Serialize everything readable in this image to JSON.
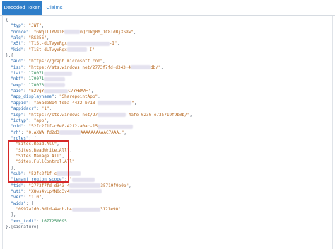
{
  "tabs": [
    {
      "label": "Decoded Token",
      "active": true
    },
    {
      "label": "Claims",
      "active": false
    }
  ],
  "token_lines": [
    {
      "t": [
        [
          "p",
          "{"
        ]
      ]
    },
    {
      "t": [
        [
          "p",
          "  "
        ],
        [
          "k",
          "\"typ\""
        ],
        [
          "p",
          ": "
        ],
        [
          "s",
          "\"JWT\""
        ],
        [
          "p",
          ","
        ]
      ]
    },
    {
      "t": [
        [
          "p",
          "  "
        ],
        [
          "k",
          "\"nonce\""
        ],
        [
          "p",
          ": "
        ],
        [
          "s",
          "\"GWqIITYV910"
        ],
        [
          "b",
          ""
        ],
        [
          "s",
          "mQr1kg0M_1C8ldBjXS8w\""
        ],
        [
          "p",
          ","
        ]
      ]
    },
    {
      "t": [
        [
          "p",
          "  "
        ],
        [
          "k",
          "\"alg\""
        ],
        [
          "p",
          ": "
        ],
        [
          "s",
          "\"RS256\""
        ],
        [
          "p",
          ","
        ]
      ]
    },
    {
      "t": [
        [
          "p",
          "  "
        ],
        [
          "k",
          "\"x5t\""
        ],
        [
          "p",
          ": "
        ],
        [
          "s",
          "\"T1St-dLTvyWRgx"
        ],
        [
          "b",
          ""
        ],
        [
          "s",
          "-I\""
        ],
        [
          "p",
          ","
        ]
      ]
    },
    {
      "t": [
        [
          "p",
          "  "
        ],
        [
          "k",
          "\"kid\""
        ],
        [
          "p",
          ": "
        ],
        [
          "s",
          "\"T1St-dLTvyWRgx"
        ],
        [
          "b",
          ""
        ],
        [
          "s",
          "-I\""
        ]
      ]
    },
    {
      "t": [
        [
          "p",
          "}.{"
        ]
      ]
    },
    {
      "t": [
        [
          "p",
          "  "
        ],
        [
          "k",
          "\"aud\""
        ],
        [
          "p",
          ": "
        ],
        [
          "s",
          "\"https://graph.microsoft.com\""
        ],
        [
          "p",
          ","
        ]
      ]
    },
    {
      "t": [
        [
          "p",
          "  "
        ],
        [
          "k",
          "\"iss\""
        ],
        [
          "p",
          ": "
        ],
        [
          "s",
          "\"https://sts.windows.net/2773f7fd-d343-4"
        ],
        [
          "b",
          ""
        ],
        [
          "s",
          "db/\""
        ],
        [
          "p",
          ","
        ]
      ]
    },
    {
      "t": [
        [
          "p",
          "  "
        ],
        [
          "k",
          "\"iat\""
        ],
        [
          "p",
          ": "
        ],
        [
          "n",
          "170071"
        ],
        [
          "b",
          ""
        ]
      ]
    },
    {
      "t": [
        [
          "p",
          "  "
        ],
        [
          "k",
          "\"nbf\""
        ],
        [
          "p",
          ": "
        ],
        [
          "n",
          "170071"
        ],
        [
          "b",
          ""
        ]
      ]
    },
    {
      "t": [
        [
          "p",
          "  "
        ],
        [
          "k",
          "\"exp\""
        ],
        [
          "p",
          ": "
        ],
        [
          "n",
          "170073"
        ],
        [
          "b",
          ""
        ]
      ]
    },
    {
      "t": [
        [
          "p",
          "  "
        ],
        [
          "k",
          "\"aio\""
        ],
        [
          "p",
          ": "
        ],
        [
          "s",
          "\"E2VgY"
        ],
        [
          "b",
          ""
        ],
        [
          "s",
          "C7Y+BAA=\""
        ],
        [
          "p",
          ","
        ]
      ]
    },
    {
      "t": [
        [
          "p",
          "  "
        ],
        [
          "k",
          "\"app_displayname\""
        ],
        [
          "p",
          ": "
        ],
        [
          "s",
          "\"SharepointApp\""
        ],
        [
          "p",
          ","
        ]
      ]
    },
    {
      "t": [
        [
          "p",
          "  "
        ],
        [
          "k",
          "\"appid\""
        ],
        [
          "p",
          ": "
        ],
        [
          "s",
          "\"a6ade814-fdba-4432-b718-"
        ],
        [
          "b",
          ""
        ],
        [
          "s",
          "\""
        ],
        [
          "p",
          ","
        ]
      ]
    },
    {
      "t": [
        [
          "p",
          "  "
        ],
        [
          "k",
          "\"appidacr\""
        ],
        [
          "p",
          ": "
        ],
        [
          "s",
          "\"1\""
        ],
        [
          "p",
          ","
        ]
      ]
    },
    {
      "t": [
        [
          "p",
          "  "
        ],
        [
          "k",
          "\"idp\""
        ],
        [
          "p",
          ": "
        ],
        [
          "s",
          "\"https://sts.windows.net/27"
        ],
        [
          "b",
          ""
        ],
        [
          "s",
          "-4afe-0230-e735719f9b0b/\""
        ],
        [
          "p",
          ","
        ]
      ]
    },
    {
      "t": [
        [
          "p",
          "  "
        ],
        [
          "k",
          "\"idtyp\""
        ],
        [
          "p",
          ": "
        ],
        [
          "s",
          "\"app\""
        ],
        [
          "p",
          ","
        ]
      ]
    },
    {
      "t": [
        [
          "p",
          "  "
        ],
        [
          "k",
          "\"oid\""
        ],
        [
          "p",
          ": "
        ],
        [
          "s",
          "\"52fc2f1f-c6e0-42f2-a0ac-15"
        ],
        [
          "b",
          ""
        ]
      ]
    },
    {
      "t": [
        [
          "p",
          "  "
        ],
        [
          "k",
          "\"rh\""
        ],
        [
          "p",
          ": "
        ],
        [
          "s",
          "\"0.AXWA_fd2d3"
        ],
        [
          "b",
          ""
        ],
        [
          "s",
          "AAAAAAAAAAC7AAA.\""
        ],
        [
          "p",
          ","
        ]
      ]
    },
    {
      "t": [
        [
          "p",
          "  "
        ],
        [
          "k",
          "\"roles\""
        ],
        [
          "p",
          ": ["
        ]
      ]
    },
    {
      "t": [
        [
          "p",
          "    "
        ],
        [
          "s",
          "\"Sites.Read.All\""
        ],
        [
          "p",
          ","
        ]
      ]
    },
    {
      "t": [
        [
          "p",
          "    "
        ],
        [
          "s",
          "\"Sites.ReadWrite.All\""
        ],
        [
          "p",
          ","
        ]
      ]
    },
    {
      "t": [
        [
          "p",
          "    "
        ],
        [
          "s",
          "\"Sites.Manage.All\""
        ],
        [
          "p",
          ","
        ]
      ]
    },
    {
      "t": [
        [
          "p",
          "    "
        ],
        [
          "s",
          "\"Sites.FullControl.All\""
        ]
      ]
    },
    {
      "t": [
        [
          "p",
          "  ],"
        ]
      ]
    },
    {
      "t": [
        [
          "p",
          "  "
        ],
        [
          "k",
          "\"sub\""
        ],
        [
          "p",
          ": "
        ],
        [
          "s",
          "\"52fc2f1f-c"
        ],
        [
          "b",
          ""
        ]
      ]
    },
    {
      "t": [
        [
          "p",
          "  "
        ],
        [
          "k",
          "\"tenant_region_scope\""
        ],
        [
          "p",
          ": "
        ],
        [
          "s",
          "\""
        ],
        [
          "b",
          ""
        ]
      ]
    },
    {
      "t": [
        [
          "p",
          "  "
        ],
        [
          "k",
          "\"tid\""
        ],
        [
          "p",
          ": "
        ],
        [
          "s",
          "\"2773f7fd-d343-4"
        ],
        [
          "b",
          ""
        ],
        [
          "s",
          "35719f9b0b\""
        ],
        [
          "p",
          ","
        ]
      ]
    },
    {
      "t": [
        [
          "p",
          "  "
        ],
        [
          "k",
          "\"uti\""
        ],
        [
          "p",
          ": "
        ],
        [
          "s",
          "\"X8ws4vLpMN0d3v4"
        ],
        [
          "b",
          ""
        ]
      ]
    },
    {
      "t": [
        [
          "p",
          "  "
        ],
        [
          "k",
          "\"ver\""
        ],
        [
          "p",
          ": "
        ],
        [
          "s",
          "\"1.0\""
        ],
        [
          "p",
          ","
        ]
      ]
    },
    {
      "t": [
        [
          "p",
          "  "
        ],
        [
          "k",
          "\"wids\""
        ],
        [
          "p",
          ": ["
        ]
      ]
    },
    {
      "t": [
        [
          "p",
          "    "
        ],
        [
          "s",
          "\"0997a1d0-0d1d-4acb-b4"
        ],
        [
          "b",
          ""
        ],
        [
          "s",
          "3121e90\""
        ]
      ]
    },
    {
      "t": [
        [
          "p",
          "  ],"
        ]
      ]
    },
    {
      "t": [
        [
          "p",
          "  "
        ],
        [
          "k",
          "\"xms_tcdt\""
        ],
        [
          "p",
          ": "
        ],
        [
          "n",
          "1677250095"
        ]
      ]
    },
    {
      "t": [
        [
          "p",
          "}.[signature]"
        ]
      ]
    }
  ]
}
